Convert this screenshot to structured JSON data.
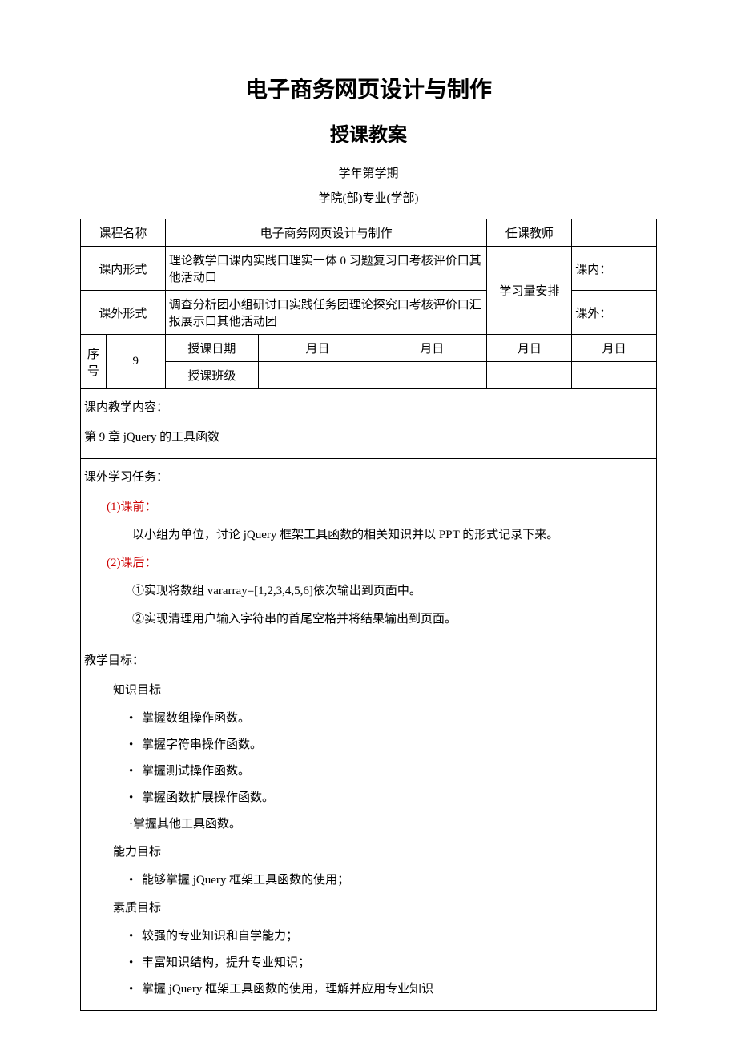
{
  "header": {
    "title": "电子商务网页设计与制作",
    "subtitle": "授课教案",
    "semester": "学年第学期",
    "college": "学院(部)专业(学部)"
  },
  "table": {
    "row1": {
      "label_course": "课程名称",
      "course_name": "电子商务网页设计与制作",
      "label_teacher": "任课教师",
      "teacher": ""
    },
    "row2": {
      "label_inclass": "课内形式",
      "inclass_value": "理论教学口课内实践口理实一体 0 习题复习口考核评价口其他活动口",
      "label_arrange": "学习量安排",
      "inclass_amount": "课内："
    },
    "row3": {
      "label_outclass": "课外形式",
      "outclass_value": "调查分析团小组研讨口实践任务团理论探究口考核评价口汇报展示口其他活动团",
      "outclass_amount": "课外："
    },
    "row4": {
      "label_seq": "序号",
      "seq_value": "9",
      "label_date": "授课日期",
      "md1": "月日",
      "md2": "月日",
      "md3": "月日",
      "md4": "月日"
    },
    "row5": {
      "label_class": "授课班级"
    }
  },
  "content": {
    "inclass_content_label": "课内教学内容：",
    "chapter": "第 9 章 jQuery 的工具函数",
    "outclass_task_label": "课外学习任务：",
    "preclass_label": "(1)课前：",
    "preclass_text": "以小组为单位，讨论 jQuery 框架工具函数的相关知识并以 PPT 的形式记录下来。",
    "postclass_label": "(2)课后：",
    "postclass_item1": "①实现将数组 vararray=[1,2,3,4,5,6]依次输出到页面中。",
    "postclass_item2": "②实现清理用户输入字符串的首尾空格并将结果输出到页面。",
    "goals_label": "教学目标：",
    "knowledge_label": "知识目标",
    "knowledge_items": {
      "0": "掌握数组操作函数。",
      "1": "掌握字符串操作函数。",
      "2": "掌握测试操作函数。",
      "3": "掌握函数扩展操作函数。",
      "4": "·掌握其他工具函数。"
    },
    "ability_label": "能力目标",
    "ability_items": {
      "0": "能够掌握 jQuery 框架工具函数的使用；"
    },
    "quality_label": "素质目标",
    "quality_items": {
      "0": "较强的专业知识和自学能力；",
      "1": "丰富知识结构，提升专业知识；",
      "2": "掌握 jQuery 框架工具函数的使用，理解并应用专业知识"
    }
  }
}
